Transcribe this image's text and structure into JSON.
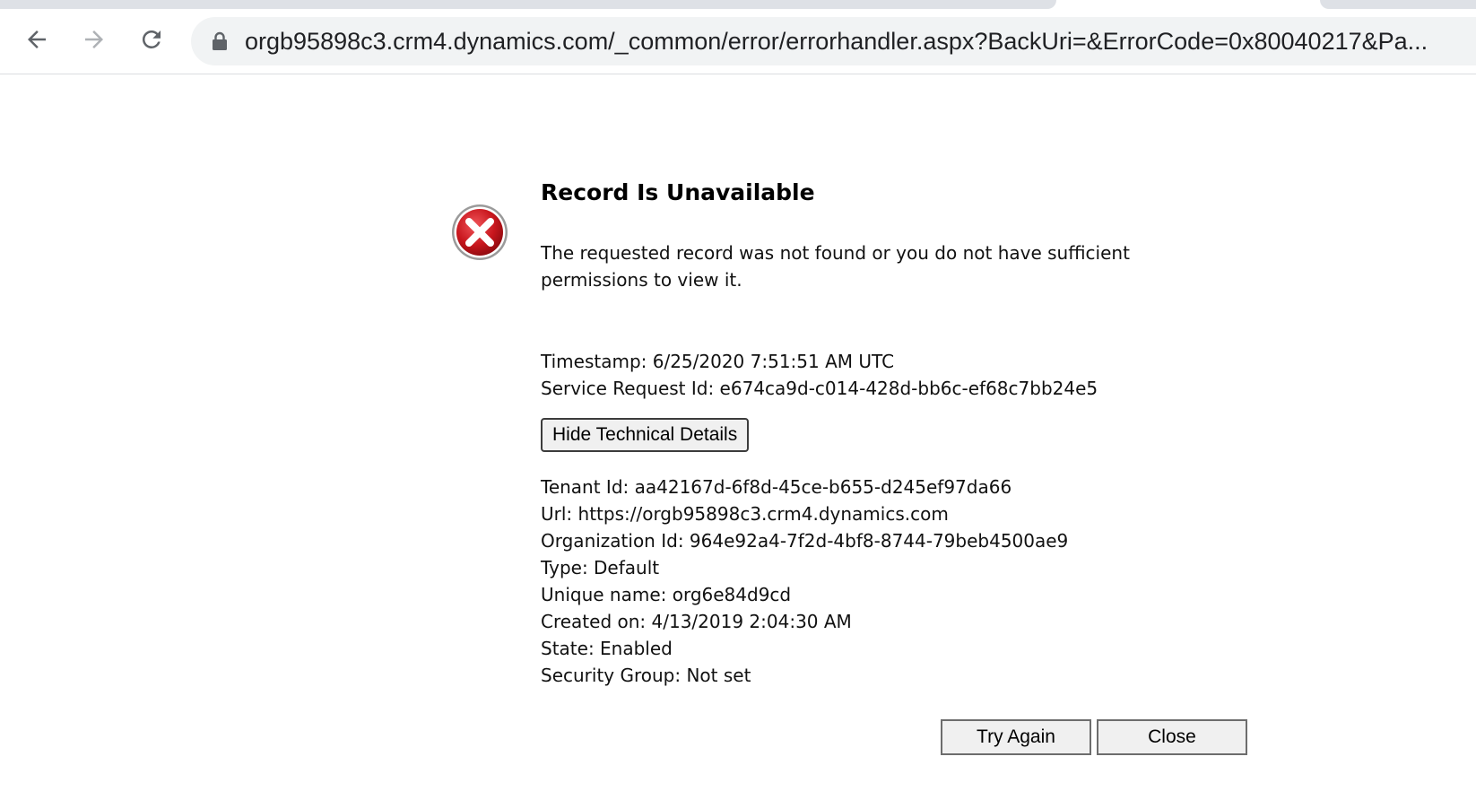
{
  "browser": {
    "address": "orgb95898c3.crm4.dynamics.com/_common/error/errorhandler.aspx?BackUri=&ErrorCode=0x80040217&Pa...",
    "icons": {
      "back": "arrow-left-icon",
      "forward": "arrow-right-icon",
      "reload": "reload-icon",
      "secure": "lock-icon"
    }
  },
  "error": {
    "title": "Record Is Unavailable",
    "message": "The requested record was not found or you do not have sufficient permissions to view it.",
    "timestamp": "Timestamp: 6/25/2020 7:51:51 AM UTC",
    "service_request": "Service Request Id: e674ca9d-c014-428d-bb6c-ef68c7bb24e5",
    "toggle_label": "Hide Technical Details",
    "details": [
      "Tenant Id: aa42167d-6f8d-45ce-b655-d245ef97da66",
      "Url: https://orgb95898c3.crm4.dynamics.com",
      "Organization Id: 964e92a4-7f2d-4bf8-8744-79beb4500ae9",
      "Type: Default",
      "Unique name: org6e84d9cd",
      "Created on: 4/13/2019 2:04:30 AM",
      "State: Enabled",
      "Security Group: Not set"
    ],
    "icon": "error-x-icon",
    "icon_color": "#c8161d"
  },
  "actions": {
    "try_again": "Try Again",
    "close": "Close"
  }
}
